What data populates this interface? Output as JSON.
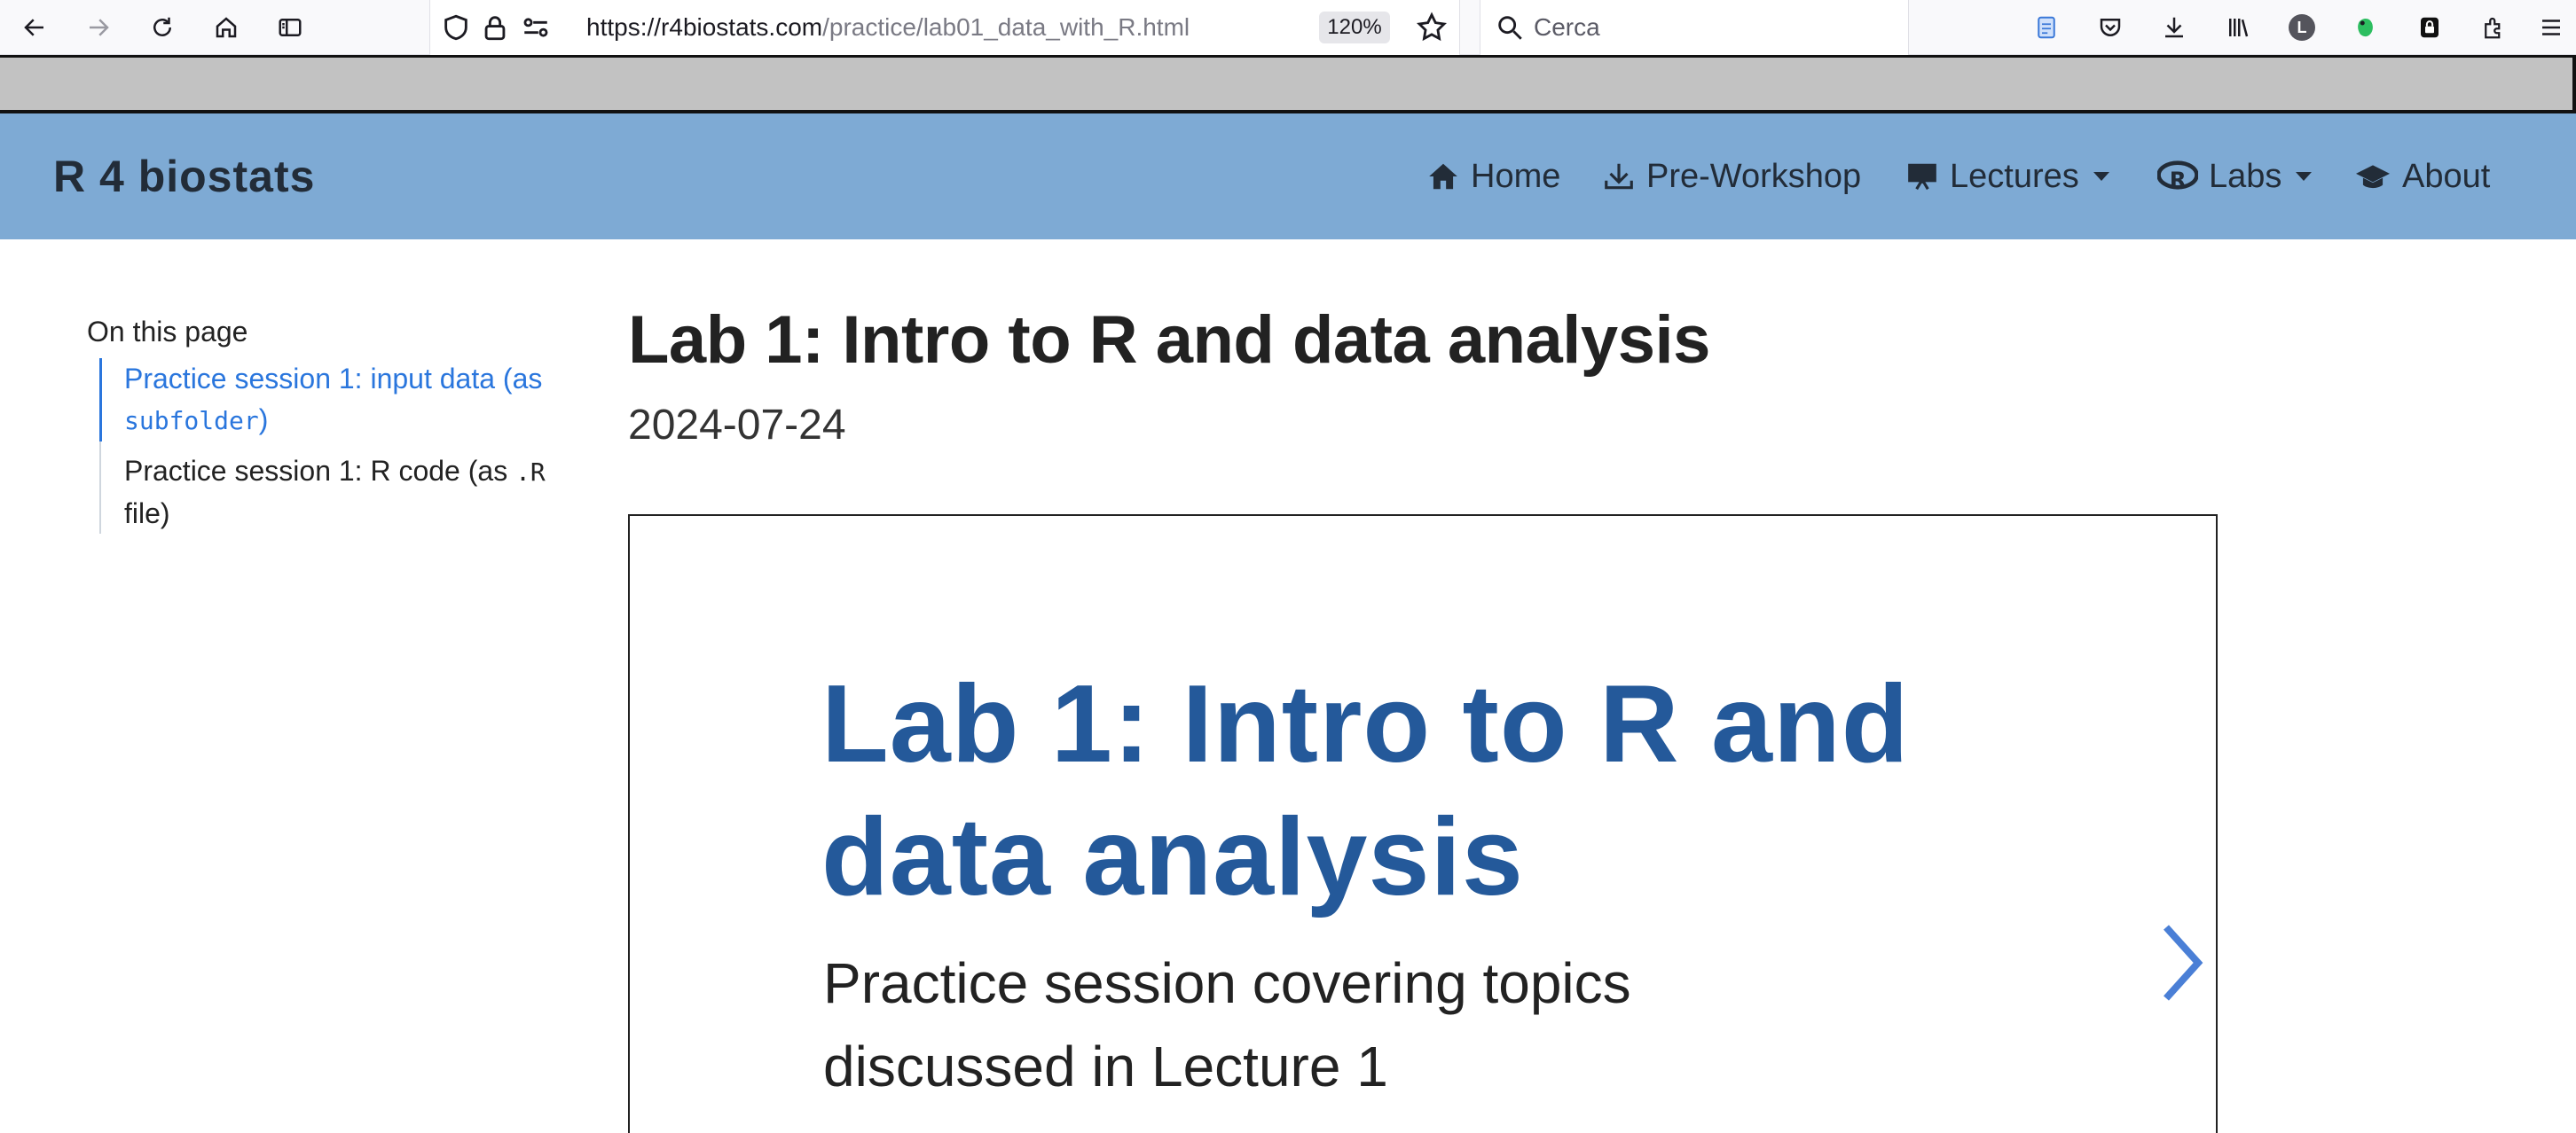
{
  "browser": {
    "url_host": "https://r4biostats.com",
    "url_path": "/practice/lab01_data_with_R.html",
    "zoom": "120%",
    "search_placeholder": "Cerca",
    "profile_initial": "L"
  },
  "site": {
    "brand": "R 4 biostats",
    "nav": {
      "home": "Home",
      "preworkshop": "Pre-Workshop",
      "lectures": "Lectures",
      "labs": "Labs",
      "about": "About"
    },
    "accent_color": "#7eaad4"
  },
  "toc": {
    "title": "On this page",
    "item1_text": "Practice session 1: input data (as ",
    "item1_code": "subfolder",
    "item1_tail": ")",
    "item2_text": "Practice session 1: R code (as ",
    "item2_code": ".R",
    "item2_tail": " file)"
  },
  "main": {
    "title": "Lab 1: Intro to R and data analysis",
    "date": "2024-07-24"
  },
  "slide": {
    "title": "Lab 1: Intro to R and data analysis",
    "subtitle": "Practice session covering topics discussed in Lecture 1",
    "title_color": "#24599a"
  }
}
